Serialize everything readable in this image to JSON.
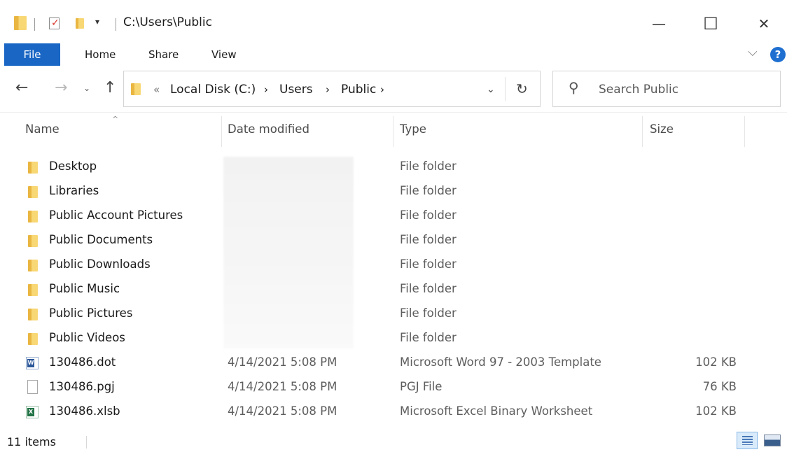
{
  "titlebar": {
    "path": "C:\\Users\\Public",
    "icons": [
      "folder-icon",
      "properties-checkmark-icon",
      "folder-small-icon",
      "customize-dropdown-icon"
    ],
    "minimize": "—",
    "maximize": "☐",
    "close": "✕"
  },
  "ribbon": {
    "tabs": [
      {
        "label": "File",
        "active": true
      },
      {
        "label": "Home"
      },
      {
        "label": "Share"
      },
      {
        "label": "View"
      }
    ]
  },
  "address": {
    "prefix": "«",
    "crumbs": [
      "Local Disk (C:)",
      "Users",
      "Public"
    ],
    "search_placeholder": "Search Public"
  },
  "columns": {
    "name": "Name",
    "date": "Date modified",
    "type": "Type",
    "size": "Size"
  },
  "files": [
    {
      "name": "Desktop",
      "date": "",
      "type": "File folder",
      "size": "",
      "icon": "folder-icon"
    },
    {
      "name": "Libraries",
      "date": "",
      "type": "File folder",
      "size": "",
      "icon": "folder-icon"
    },
    {
      "name": "Public Account Pictures",
      "date": "",
      "type": "File folder",
      "size": "",
      "icon": "folder-icon"
    },
    {
      "name": "Public Documents",
      "date": "",
      "type": "File folder",
      "size": "",
      "icon": "folder-icon"
    },
    {
      "name": "Public Downloads",
      "date": "",
      "type": "File folder",
      "size": "",
      "icon": "folder-icon"
    },
    {
      "name": "Public Music",
      "date": "",
      "type": "File folder",
      "size": "",
      "icon": "folder-icon"
    },
    {
      "name": "Public Pictures",
      "date": "",
      "type": "File folder",
      "size": "",
      "icon": "folder-icon"
    },
    {
      "name": "Public Videos",
      "date": "",
      "type": "File folder",
      "size": "",
      "icon": "folder-icon"
    },
    {
      "name": "130486.dot",
      "date": "4/14/2021 5:08 PM",
      "type": "Microsoft Word 97 - 2003 Template",
      "size": "102 KB",
      "icon": "word-template-icon"
    },
    {
      "name": "130486.pgj",
      "date": "4/14/2021 5:08 PM",
      "type": "PGJ File",
      "size": "76 KB",
      "icon": "generic-file-icon"
    },
    {
      "name": "130486.xlsb",
      "date": "4/14/2021 5:08 PM",
      "type": "Microsoft Excel Binary Worksheet",
      "size": "102 KB",
      "icon": "excel-binary-icon"
    }
  ],
  "status": {
    "count": "11 items"
  },
  "colors": {
    "file_tab": "#1966c5",
    "folder": "#f8d775",
    "help": "#1f6fd1"
  }
}
